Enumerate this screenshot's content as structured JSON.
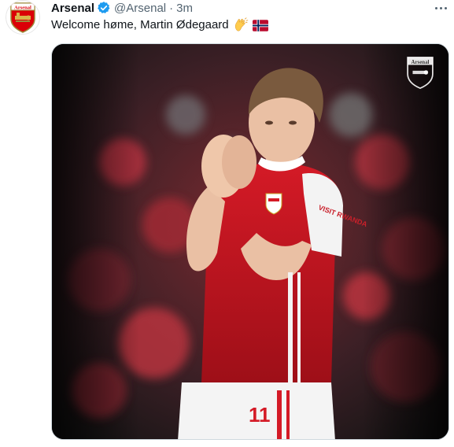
{
  "tweet": {
    "author_name": "Arsenal",
    "handle": "@Arsenal",
    "separator": "·",
    "time": "3m",
    "text": "Welcome høme, Martin Ødegaard",
    "emoji": [
      "clapping-hands",
      "norway-flag"
    ],
    "verified": true,
    "media": {
      "type": "video-still",
      "watermark_text": "Arsenal",
      "shirt_sponsor": "VISIT RWANDA",
      "shirt_number": "11"
    }
  },
  "colors": {
    "verified_blue": "#1d9bf0",
    "text": "#0f1419",
    "muted": "#536471",
    "arsenal_red": "#db0007"
  }
}
